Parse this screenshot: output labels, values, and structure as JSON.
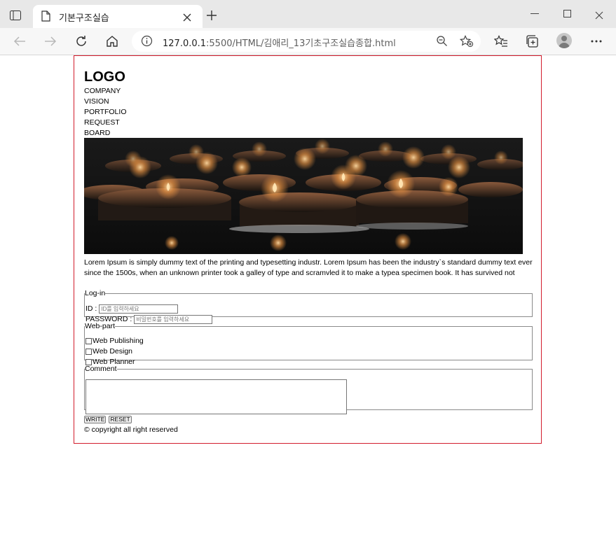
{
  "browser": {
    "tab_title": "기본구조실습",
    "url_host": "127.0.0.1",
    "url_path": ":5500/HTML/김애리_13기초구조실습종합.html"
  },
  "page": {
    "logo": "LOGO",
    "nav": [
      "COMPANY",
      "VISION",
      "PORTFOLIO",
      "REQUEST",
      "BOARD"
    ],
    "intro_text": "Lorem Ipsum is simply dummy text of the printing and typesetting industr. Lorem Ipsum has been the industry`s standard dummy text ever since the 1500s, when an unknown printer took a galley of type and scramvled it to make a typea specimen book. It has survived not",
    "login": {
      "legend": "Log-in",
      "id_label": "ID : ",
      "id_placeholder": "ID를 입력하세요",
      "pw_label": "PASSWORD : ",
      "pw_placeholder": "비밀번호를 입력하세요"
    },
    "webpart": {
      "legend": "Web-part",
      "options": [
        "Web Publishing",
        "Web Design",
        "Web Planner"
      ]
    },
    "comment": {
      "legend": "Comment"
    },
    "buttons": {
      "write": "WRITE",
      "reset": "RESET"
    },
    "copyright": "© copyright all right reserved"
  },
  "colors": {
    "frame_border": "#d21c2c",
    "candle_flame": "#f4a14a"
  }
}
